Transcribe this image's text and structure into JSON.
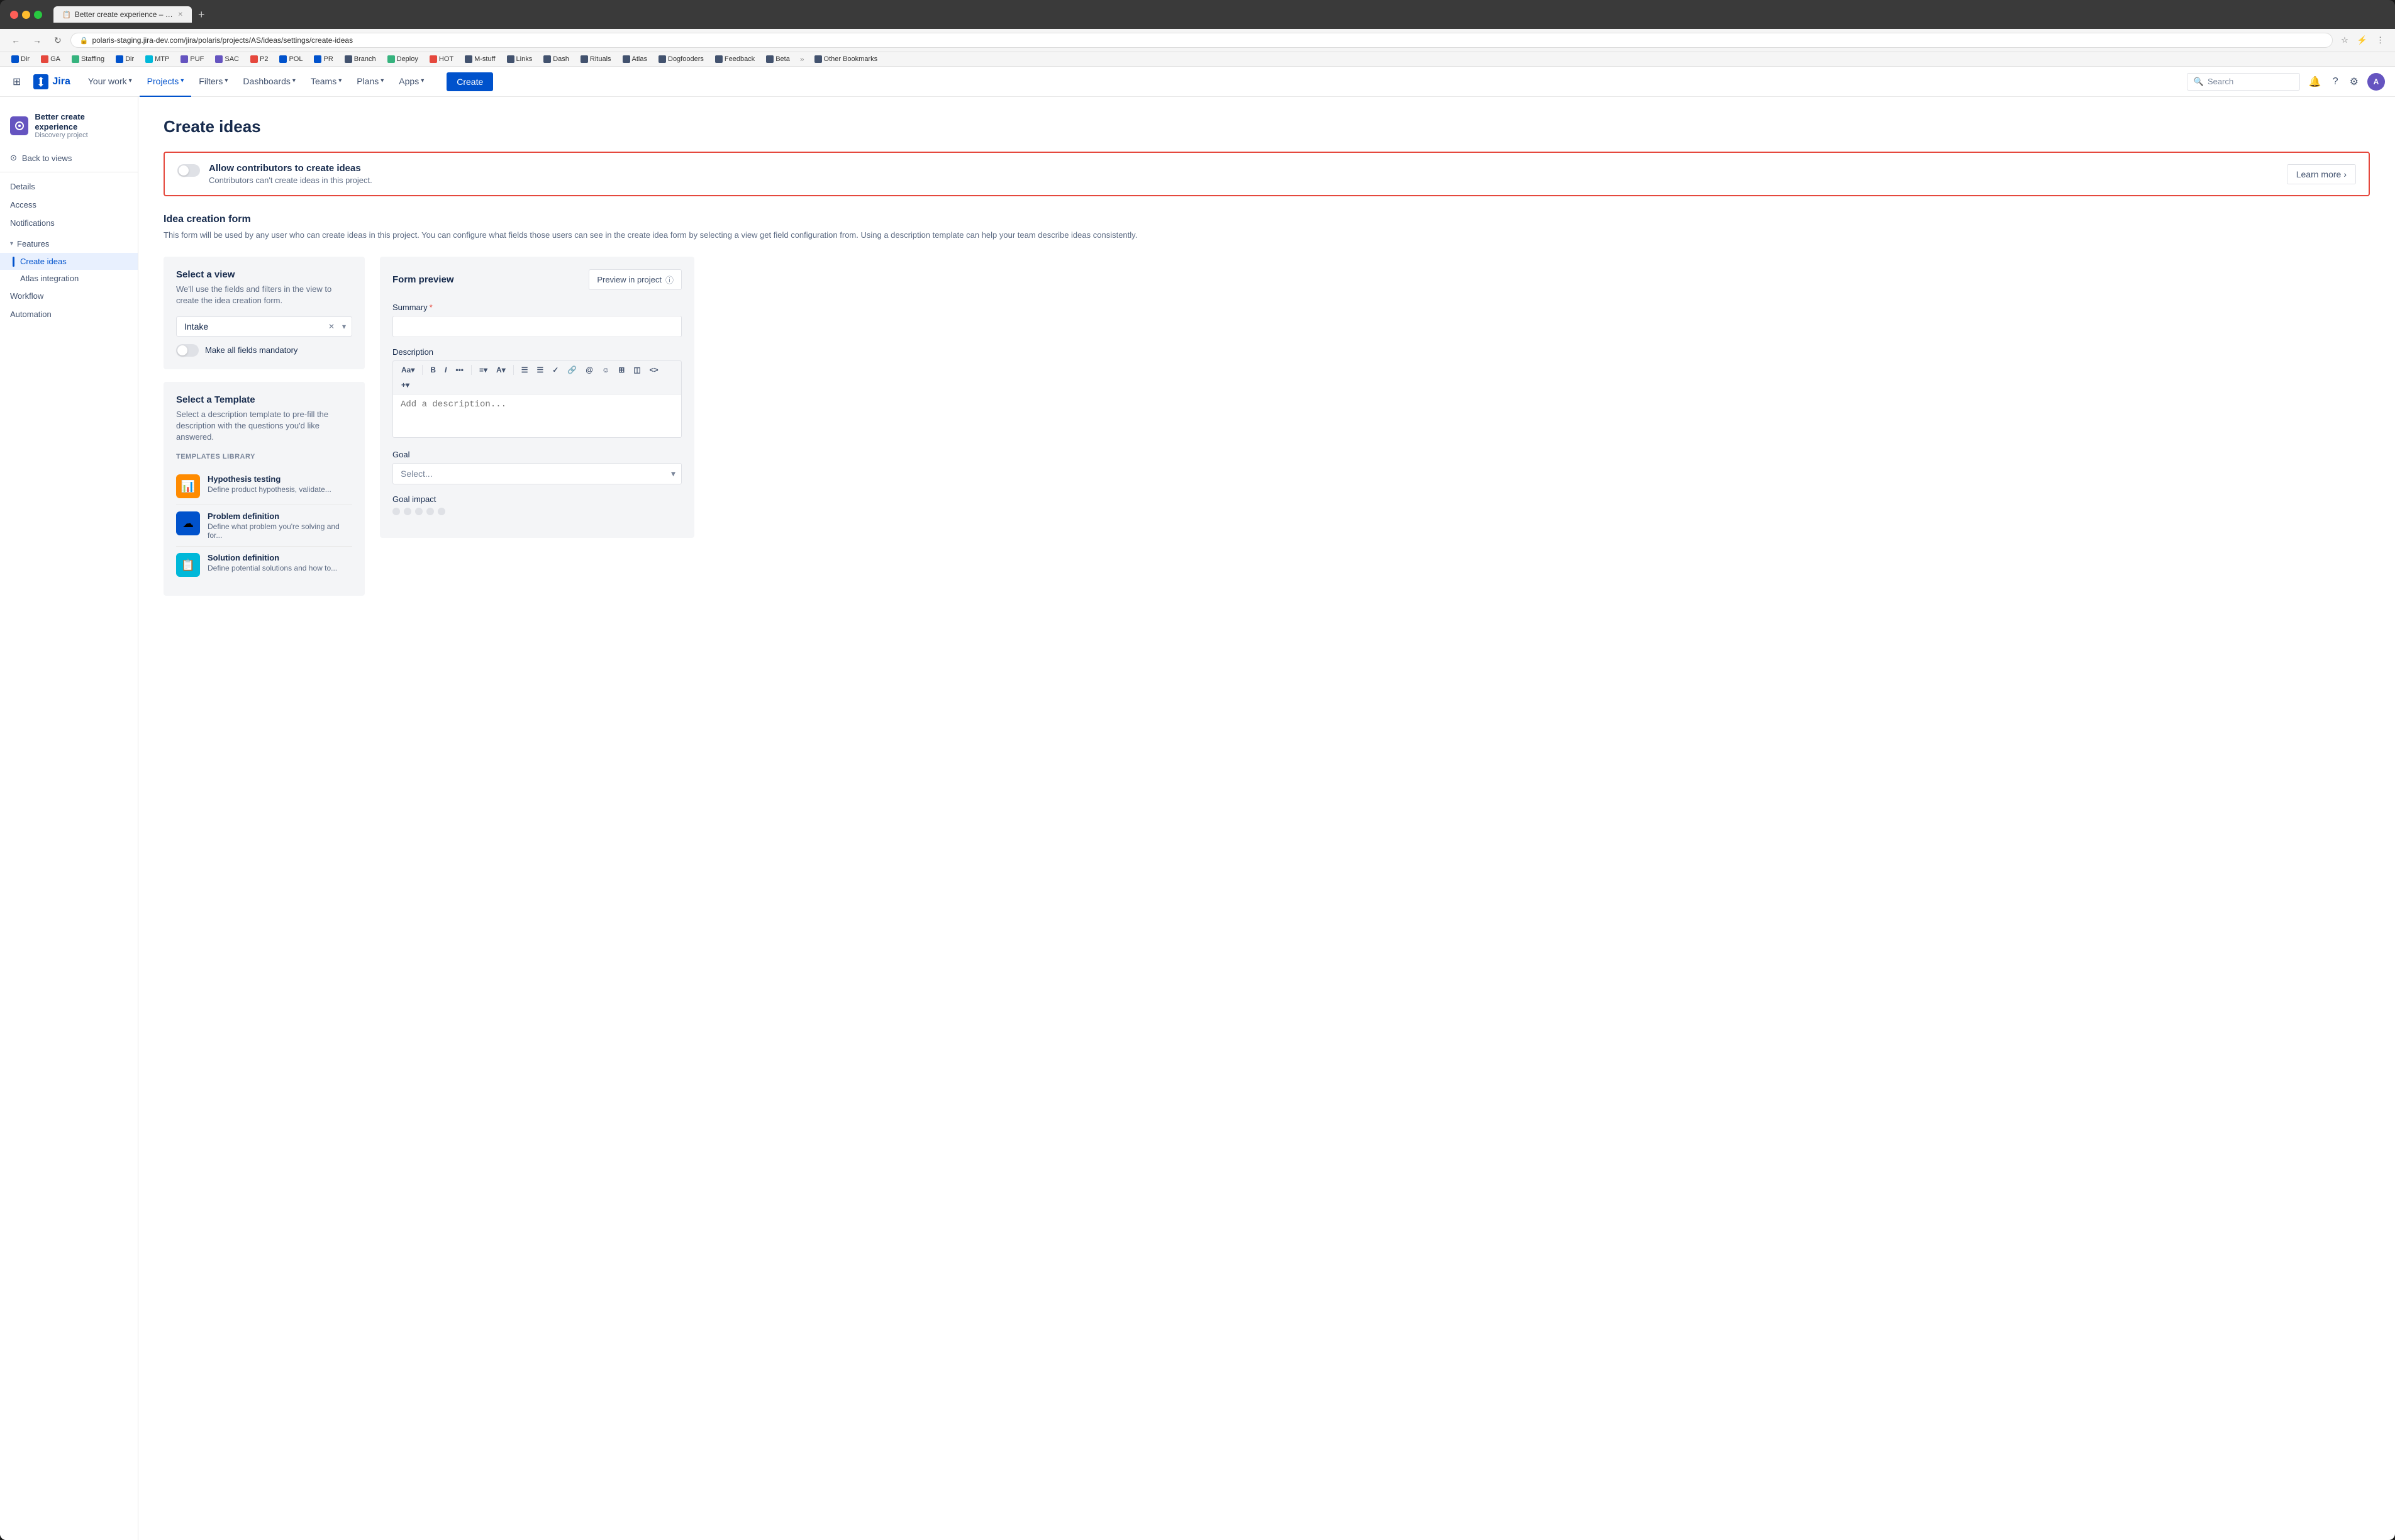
{
  "browser": {
    "tab_title": "Better create experience – Jira",
    "url": "polaris-staging.jira-dev.com/jira/polaris/projects/AS/ideas/settings/create-ideas",
    "new_tab_btn": "+",
    "nav_back": "←",
    "nav_forward": "→",
    "nav_refresh": "↻"
  },
  "bookmarks": [
    {
      "label": "Dir",
      "color": "#0052cc"
    },
    {
      "label": "GA",
      "color": "#e5483d"
    },
    {
      "label": "Staffing",
      "color": "#36b37e"
    },
    {
      "label": "Dir",
      "color": "#0052cc"
    },
    {
      "label": "MTP",
      "color": "#00b8d9"
    },
    {
      "label": "PUF",
      "color": "#6554c0"
    },
    {
      "label": "SAC",
      "color": "#6554c0"
    },
    {
      "label": "P2",
      "color": "#e5483d"
    },
    {
      "label": "POL",
      "color": "#0052cc"
    },
    {
      "label": "PR",
      "color": "#0052cc"
    },
    {
      "label": "Branch",
      "color": "#42526e"
    },
    {
      "label": "Deploy",
      "color": "#36b37e"
    },
    {
      "label": "HOT",
      "color": "#e5483d"
    },
    {
      "label": "M-stuff",
      "color": "#42526e"
    },
    {
      "label": "Links",
      "color": "#42526e"
    },
    {
      "label": "Dash",
      "color": "#42526e"
    },
    {
      "label": "Rituals",
      "color": "#42526e"
    },
    {
      "label": "Atlas",
      "color": "#42526e"
    },
    {
      "label": "Dogfooders",
      "color": "#42526e"
    },
    {
      "label": "Feedback",
      "color": "#42526e"
    },
    {
      "label": "Beta",
      "color": "#42526e"
    },
    {
      "label": "Other Bookmarks",
      "color": "#42526e"
    }
  ],
  "topnav": {
    "logo_text": "Jira",
    "items": [
      {
        "label": "Your work",
        "has_chevron": true,
        "active": false
      },
      {
        "label": "Projects",
        "has_chevron": true,
        "active": true
      },
      {
        "label": "Filters",
        "has_chevron": true,
        "active": false
      },
      {
        "label": "Dashboards",
        "has_chevron": true,
        "active": false
      },
      {
        "label": "Teams",
        "has_chevron": true,
        "active": false
      },
      {
        "label": "Plans",
        "has_chevron": true,
        "active": false
      },
      {
        "label": "Apps",
        "has_chevron": true,
        "active": false
      }
    ],
    "create_label": "Create",
    "search_placeholder": "Search",
    "avatar_initials": "A"
  },
  "sidebar": {
    "project_name": "Better create experience",
    "project_type": "Discovery project",
    "back_label": "Back to views",
    "items": [
      {
        "label": "Details",
        "active": false
      },
      {
        "label": "Access",
        "active": false
      },
      {
        "label": "Notifications",
        "active": false
      }
    ],
    "features_section": {
      "label": "Features",
      "sub_items": [
        {
          "label": "Create ideas",
          "active": true
        },
        {
          "label": "Atlas integration",
          "active": false
        }
      ]
    },
    "bottom_items": [
      {
        "label": "Workflow",
        "active": false
      },
      {
        "label": "Automation",
        "active": false
      }
    ]
  },
  "page": {
    "title": "Create ideas",
    "alert": {
      "toggle_state": "off",
      "title": "Allow contributors to create ideas",
      "description": "Contributors can't create ideas in this project.",
      "learn_more_label": "Learn more",
      "learn_more_chevron": "›"
    },
    "form_section": {
      "title": "Idea creation form",
      "description": "This form will be used by any user who can create ideas in this project. You can configure what fields those users can see in the create idea form by selecting a view get field configuration from. Using a description template can help your team describe ideas consistently."
    },
    "select_view": {
      "card_title": "Select a view",
      "card_desc": "We'll use the fields and filters in the view to create the idea creation form.",
      "current_value": "Intake",
      "toggle_label": "Make all fields mandatory"
    },
    "select_template": {
      "card_title": "Select a Template",
      "card_desc": "Select a description template to pre-fill the description with the questions you'd like answered.",
      "library_label": "TEMPLATES LIBRARY",
      "templates": [
        {
          "name": "Hypothesis testing",
          "desc": "Define product hypothesis, validate...",
          "icon_emoji": "📊",
          "icon_color": "#ff8b00"
        },
        {
          "name": "Problem definition",
          "desc": "Define what problem you're solving and for...",
          "icon_emoji": "☁",
          "icon_color": "#0052cc"
        },
        {
          "name": "Solution definition",
          "desc": "Define potential solutions and how to...",
          "icon_emoji": "📋",
          "icon_color": "#00b8d9"
        }
      ]
    },
    "form_preview": {
      "title": "Form preview",
      "preview_btn_label": "Preview in project",
      "summary_label": "Summary",
      "summary_required": "*",
      "description_label": "Description",
      "description_placeholder": "Add a description...",
      "toolbar_items": [
        "Aa▾",
        "B",
        "I",
        "•••",
        "≡▾",
        "A▾",
        "☰",
        "☰",
        "✓",
        "🔗",
        "@",
        "☺",
        "⊞",
        "◫",
        "<>",
        "+▾"
      ],
      "goal_label": "Goal",
      "goal_placeholder": "Select...",
      "goal_impact_label": "Goal impact"
    }
  }
}
